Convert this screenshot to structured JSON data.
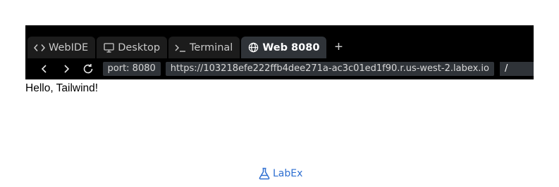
{
  "tabs": [
    {
      "label": "WebIDE",
      "icon": "code-icon",
      "active": false
    },
    {
      "label": "Desktop",
      "icon": "monitor-icon",
      "active": false
    },
    {
      "label": "Terminal",
      "icon": "terminal-icon",
      "active": false
    },
    {
      "label": "Web 8080",
      "icon": "globe-icon",
      "active": true
    }
  ],
  "add_tab_label": "+",
  "nav": {
    "back_icon": "chevron-left-icon",
    "forward_icon": "chevron-right-icon",
    "reload_icon": "reload-icon",
    "port": "port: 8080",
    "url": "https://103218efe222ffb4dee271a-ac3c01ed1f90.r.us-west-2.labex.io",
    "path": "/"
  },
  "page_content": "Hello, Tailwind!",
  "brand": {
    "name": "LabEx",
    "icon": "flask-icon",
    "color": "#2e6fd1"
  },
  "colors": {
    "bar_background": "#000000",
    "active_tab": "#2f3338",
    "inactive_tab": "#1c1c1c",
    "pill_background": "#2f3338"
  }
}
